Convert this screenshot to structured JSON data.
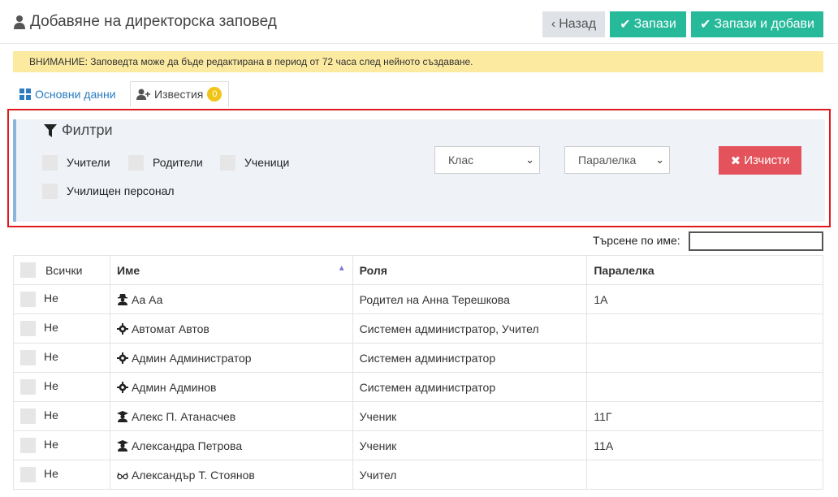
{
  "header": {
    "title": "Добавяне на директорска заповед",
    "back_label": "Назад",
    "save_label": "Запази",
    "save_add_label": "Запази и добави"
  },
  "warning": "ВНИМАНИЕ: Заповедта може да бъде редактирана в период от 72 часа след нейното създаване.",
  "tabs": [
    {
      "label": "Основни данни",
      "icon": "grid-icon"
    },
    {
      "label": "Известия",
      "icon": "user-plus-icon",
      "badge": "0"
    }
  ],
  "filters": {
    "title": "Филтри",
    "checkboxes": [
      "Учители",
      "Родители",
      "Ученици",
      "Училищен персонал"
    ],
    "class_select": "Клас",
    "section_select": "Паралелка",
    "clear_label": "Изчисти"
  },
  "search": {
    "label": "Търсене по име:",
    "value": ""
  },
  "table": {
    "headers": [
      "Всички",
      "Име",
      "Роля",
      "Паралелка"
    ],
    "rows": [
      {
        "selected": "Не",
        "icon": "user-secret-icon",
        "name": "Аа Аа",
        "role": "Родител на Анна Терешкова",
        "section": "1А"
      },
      {
        "selected": "Не",
        "icon": "gear-icon",
        "name": "Автомат Автов",
        "role": "Системен администратор, Учител",
        "section": ""
      },
      {
        "selected": "Не",
        "icon": "gear-icon",
        "name": "Админ Администратор",
        "role": "Системен администратор",
        "section": ""
      },
      {
        "selected": "Не",
        "icon": "gear-icon",
        "name": "Админ Админов",
        "role": "Системен администратор",
        "section": ""
      },
      {
        "selected": "Не",
        "icon": "graduate-icon",
        "name": "Алекс П. Атанасчев",
        "role": "Ученик",
        "section": "11Г"
      },
      {
        "selected": "Не",
        "icon": "graduate-icon",
        "name": "Александра Петрова",
        "role": "Ученик",
        "section": "11А"
      },
      {
        "selected": "Не",
        "icon": "glasses-icon",
        "name": "Александър Т. Стоянов",
        "role": "Учител",
        "section": ""
      }
    ]
  }
}
